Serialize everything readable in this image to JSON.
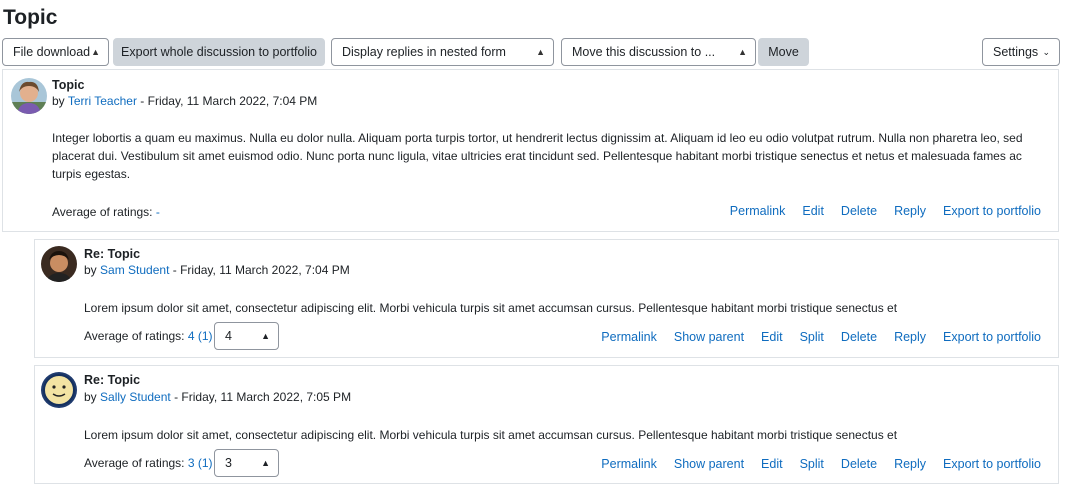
{
  "page": {
    "title": "Topic"
  },
  "toolbar": {
    "file_download": "File download",
    "export_discussion": "Export whole discussion to portfolio",
    "display_mode": "Display replies in nested form",
    "move_to": "Move this discussion to ...",
    "move": "Move",
    "settings": "Settings"
  },
  "posts": [
    {
      "subject": "Topic",
      "by": "by",
      "author": "Terri Teacher",
      "date": "- Friday, 11 March 2022, 7:04 PM",
      "content": "Integer lobortis a quam eu maximus. Nulla eu dolor nulla. Aliquam porta turpis tortor, ut hendrerit lectus dignissim at. Aliquam id leo eu odio volutpat rutrum. Nulla non pharetra leo, sed placerat dui. Vestibulum sit amet euismod odio. Nunc porta nunc ligula, vitae ultricies erat tincidunt sed. Pellentesque habitant morbi tristique senectus et netus et malesuada fames ac turpis egestas.",
      "ratings_label": "Average of ratings:",
      "ratings_value": "-",
      "actions": [
        "Permalink",
        "Edit",
        "Delete",
        "Reply",
        "Export to portfolio"
      ]
    },
    {
      "subject": "Re: Topic",
      "by": "by",
      "author": "Sam Student",
      "date": "- Friday, 11 March 2022, 7:04 PM",
      "content": "Lorem ipsum dolor sit amet, consectetur adipiscing elit. Morbi vehicula turpis sit amet accumsan cursus. Pellentesque habitant morbi tristique senectus et",
      "ratings_label": "Average of ratings:",
      "ratings_value": "4 (1)",
      "rating_select": "4",
      "actions": [
        "Permalink",
        "Show parent",
        "Edit",
        "Split",
        "Delete",
        "Reply",
        "Export to portfolio"
      ]
    },
    {
      "subject": "Re: Topic",
      "by": "by",
      "author": "Sally Student",
      "date": "- Friday, 11 March 2022, 7:05 PM",
      "content": "Lorem ipsum dolor sit amet, consectetur adipiscing elit. Morbi vehicula turpis sit amet accumsan cursus. Pellentesque habitant morbi tristique senectus et",
      "ratings_label": "Average of ratings:",
      "ratings_value": "3 (1)",
      "rating_select": "3",
      "actions": [
        "Permalink",
        "Show parent",
        "Edit",
        "Split",
        "Delete",
        "Reply",
        "Export to portfolio"
      ]
    }
  ],
  "colors": {
    "link": "#0f6cbf",
    "border": "#dee2e6",
    "button_grey": "#ced4da"
  }
}
